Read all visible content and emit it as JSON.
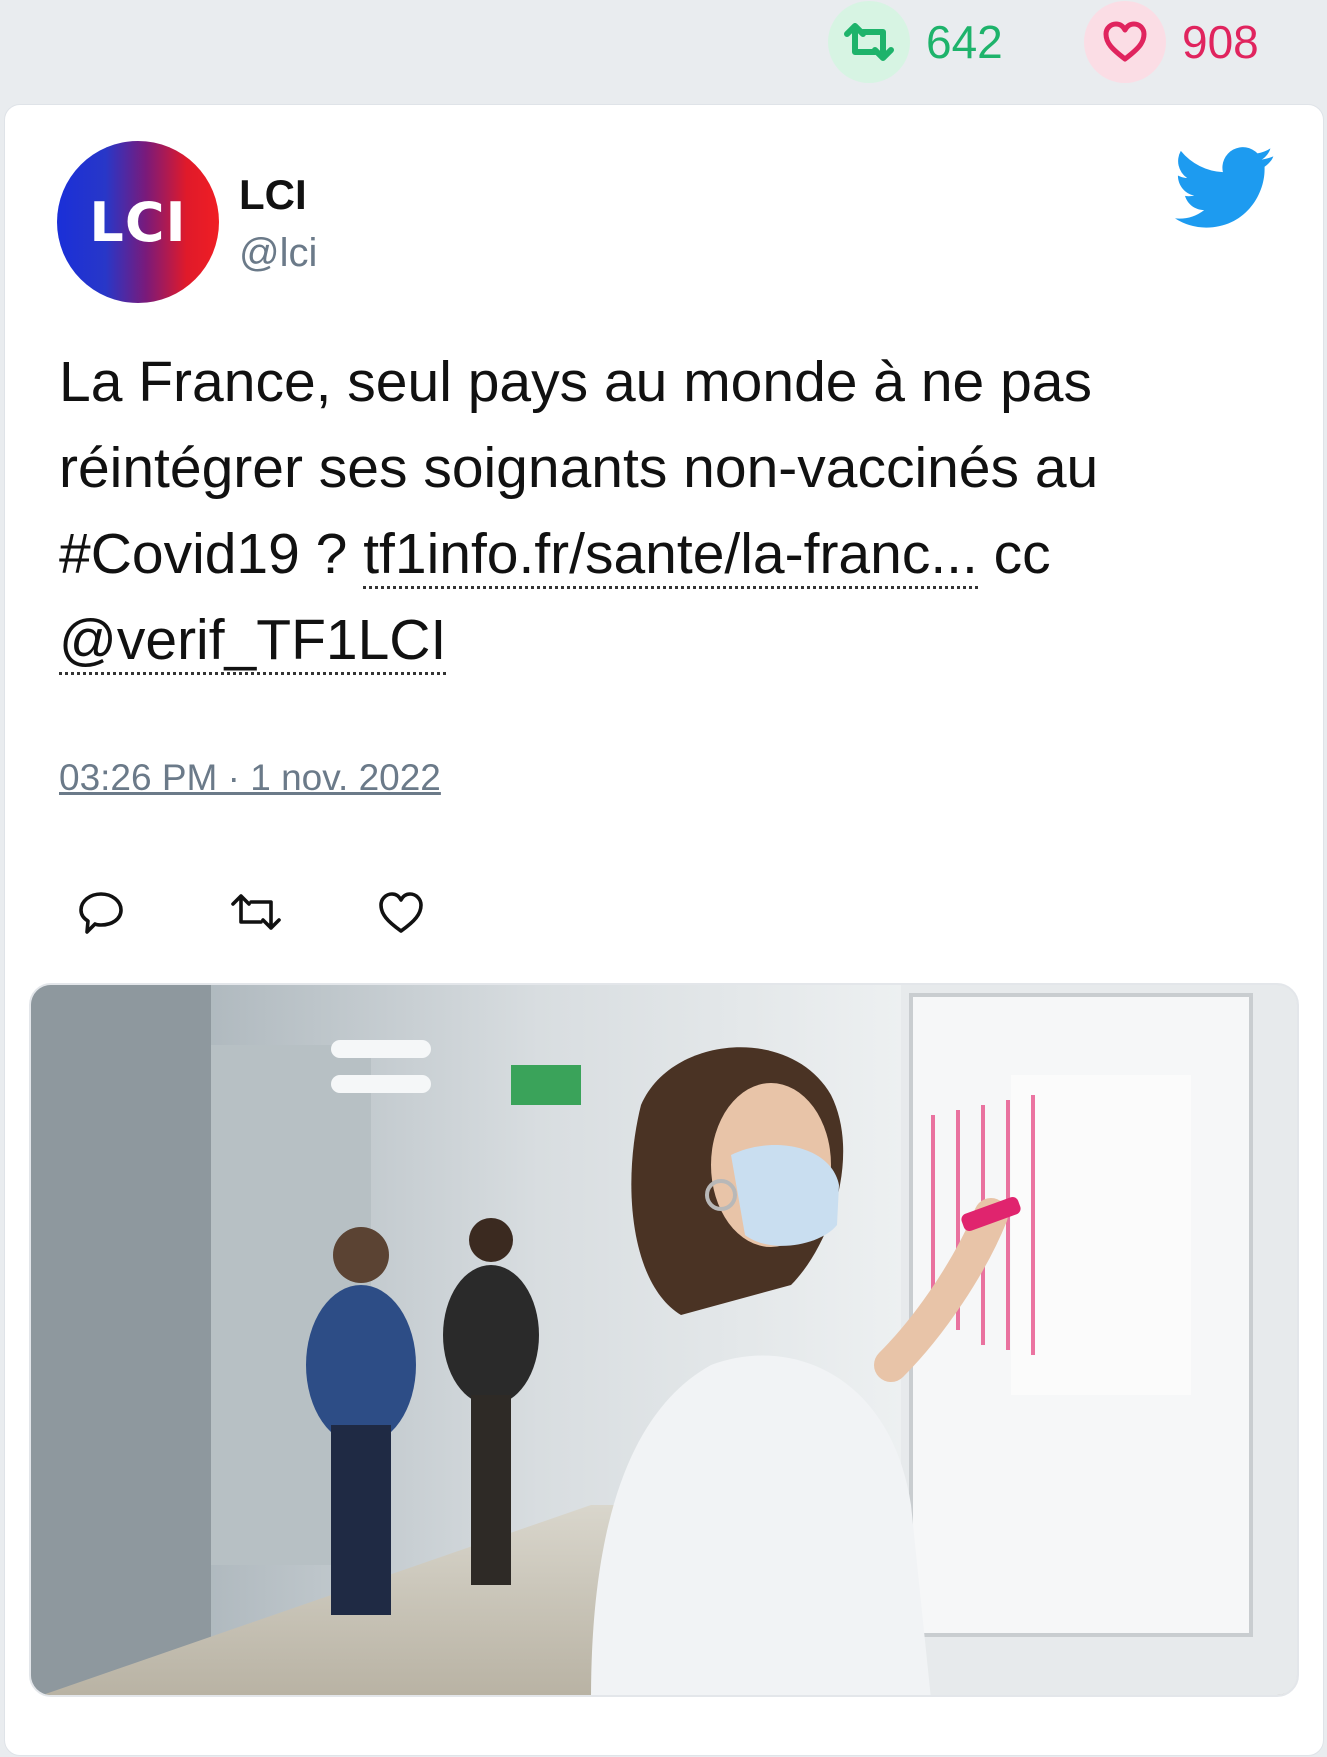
{
  "stats": {
    "retweets": "642",
    "likes": "908",
    "retweet_color": "#1eb36b",
    "like_color": "#e0245e"
  },
  "author": {
    "avatar_text": "LCI",
    "name": "LCI",
    "handle": "@lci"
  },
  "tweet": {
    "text_1": "La France, seul pays au monde à ne pas réintégrer ses soignants non-vaccinés au #Covid19 ? ",
    "link": "tf1info.fr/sante/la-franc...",
    "text_2": " cc ",
    "mention": "@verif_TF1LCI",
    "timestamp": "03:26 PM · 1 nov. 2022"
  },
  "icons": {
    "top_retweet": "retweet-icon",
    "top_like": "heart-icon",
    "brand": "twitter-bird-icon",
    "reply": "reply-icon",
    "retweet": "retweet-icon",
    "like": "heart-icon"
  },
  "media": {
    "type": "photo",
    "icon": "photo-image"
  }
}
